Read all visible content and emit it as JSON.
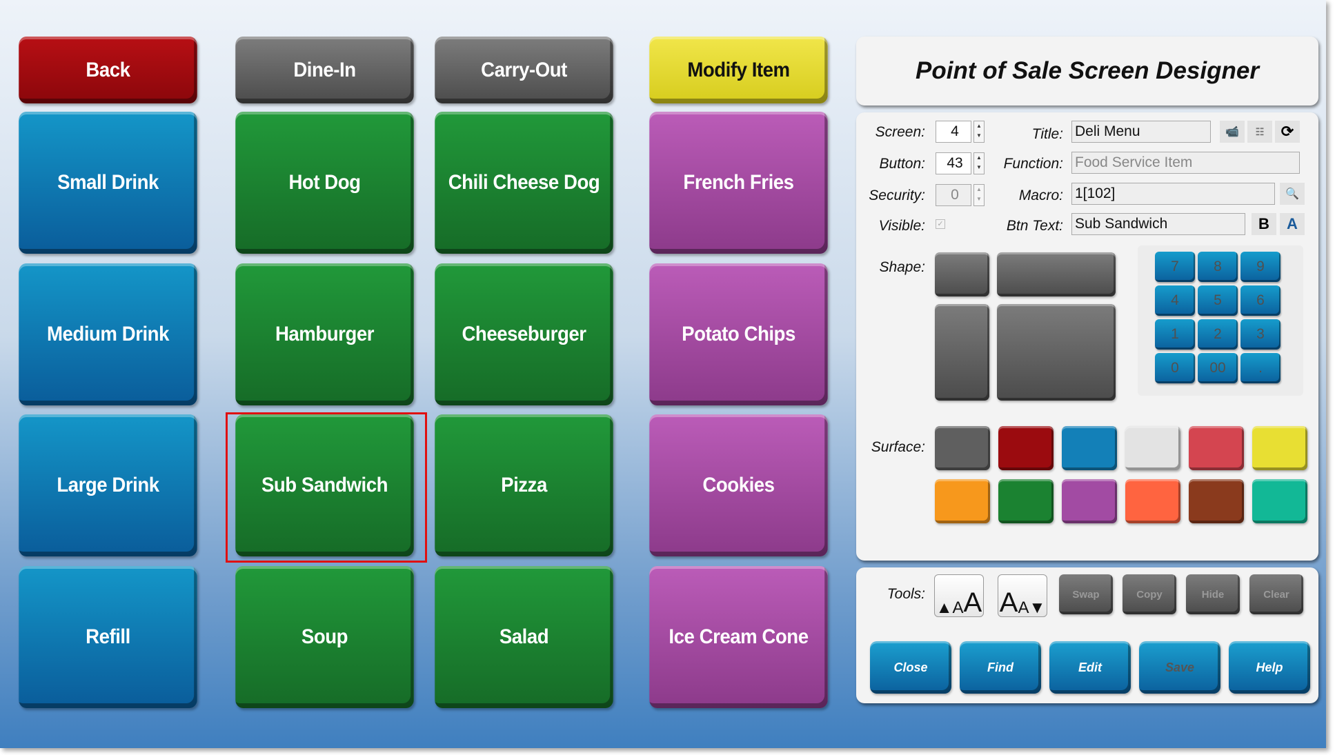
{
  "menu": {
    "top": [
      {
        "label": "Back",
        "color": "red"
      },
      {
        "label": "Dine-In",
        "color": "gray"
      },
      {
        "label": "Carry-Out",
        "color": "gray"
      },
      {
        "label": "Modify Item",
        "color": "yellow"
      }
    ],
    "columns": [
      [
        "Small Drink",
        "Medium Drink",
        "Large Drink",
        "Refill"
      ],
      [
        "Hot Dog",
        "Hamburger",
        "Sub Sandwich",
        "Soup"
      ],
      [
        "Chili Cheese Dog",
        "Cheeseburger",
        "Pizza",
        "Salad"
      ],
      [
        "French Fries",
        "Potato Chips",
        "Cookies",
        "Ice Cream Cone"
      ]
    ],
    "selected": "Sub Sandwich"
  },
  "designer": {
    "title": "Point of Sale Screen Designer",
    "labels": {
      "screen": "Screen:",
      "button": "Button:",
      "security": "Security:",
      "visible": "Visible:",
      "title": "Title:",
      "function": "Function:",
      "macro": "Macro:",
      "btn_text": "Btn Text:",
      "shape": "Shape:",
      "surface": "Surface:",
      "tools": "Tools:"
    },
    "values": {
      "screen": "4",
      "button": "43",
      "security": "0",
      "visible": true,
      "title": "Deli Menu",
      "function": "Food Service Item",
      "macro": "1[102]",
      "btn_text": "Sub Sandwich"
    },
    "keypad": [
      "7",
      "8",
      "9",
      "4",
      "5",
      "6",
      "1",
      "2",
      "3",
      "0",
      "00",
      "."
    ],
    "surface_colors": [
      "#5f5f5f",
      "#9b0b0f",
      "#1380b8",
      "#e3e3e3",
      "#d44550",
      "#e8df33",
      "#f7981c",
      "#1b8231",
      "#a24ba3",
      "#ff6440",
      "#8a3a1d",
      "#12b896"
    ],
    "tools": [
      "Swap",
      "Copy",
      "Hide",
      "Clear"
    ],
    "footer": [
      "Close",
      "Find",
      "Edit",
      "Save",
      "Help"
    ]
  }
}
